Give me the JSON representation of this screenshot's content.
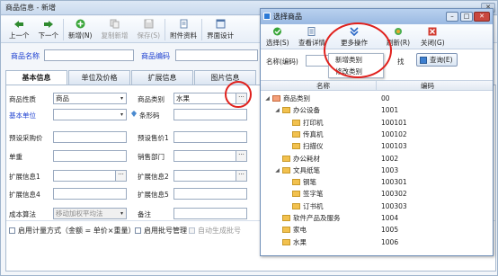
{
  "main": {
    "title": "商品信息 - 新增",
    "toolbar": {
      "prev": "上一个",
      "next": "下一个",
      "add": "新增(N)",
      "copy_add": "复制新增",
      "save": "保存(S)",
      "attach": "附件资料",
      "ui_design": "界面设计"
    },
    "name_label": "商品名称",
    "code_label": "商品编码",
    "tabs": [
      "基本信息",
      "单位及价格",
      "扩展信息",
      "图片信息"
    ],
    "fields": {
      "nature_label": "商品性质",
      "nature_value": "商品",
      "category_label": "商品类别",
      "category_value": "水果",
      "base_unit_label": "基本单位",
      "barcode_label": "条形码",
      "purchase_price_label": "预设采购价",
      "sale_price_label": "预设售价1",
      "weight_label": "单重",
      "sales_dept_label": "销售部门",
      "ext1_label": "扩展信息1",
      "ext2_label": "扩展信息2",
      "ext4_label": "扩展信息4",
      "ext5_label": "扩展信息5",
      "cost_label": "成本算法",
      "cost_value": "移动加权平均法",
      "remark_label": "备注"
    },
    "bottom": {
      "measure": "启用计量方式（金额 = 单价×重量）",
      "batch": "启用批号管理",
      "auto_batch": "自动生成批号"
    }
  },
  "dialog": {
    "title": "选择商品",
    "toolbar": {
      "select": "选择(S)",
      "details": "查看详情",
      "more": "更多操作",
      "refresh": "刷新(R)",
      "close": "关闭(G)"
    },
    "search_label": "名称(编码)",
    "partial_label": "找",
    "query": "查询(E)",
    "menu": [
      "新增类别",
      "修改类别"
    ],
    "columns": [
      "名称",
      "编码"
    ],
    "rows": [
      {
        "name": "商品类别",
        "code": "00",
        "level": 0,
        "toggle": "◢"
      },
      {
        "name": "办公设备",
        "code": "1001",
        "level": 1,
        "toggle": "◢"
      },
      {
        "name": "打印机",
        "code": "100101",
        "level": 2,
        "toggle": ""
      },
      {
        "name": "传真机",
        "code": "100102",
        "level": 2,
        "toggle": ""
      },
      {
        "name": "扫描仪",
        "code": "100103",
        "level": 2,
        "toggle": ""
      },
      {
        "name": "办公耗材",
        "code": "1002",
        "level": 1,
        "toggle": ""
      },
      {
        "name": "文具纸笔",
        "code": "1003",
        "level": 1,
        "toggle": "◢"
      },
      {
        "name": "钢笔",
        "code": "100301",
        "level": 2,
        "toggle": ""
      },
      {
        "name": "签字笔",
        "code": "100302",
        "level": 2,
        "toggle": ""
      },
      {
        "name": "订书机",
        "code": "100303",
        "level": 2,
        "toggle": ""
      },
      {
        "name": "软件产品及服务",
        "code": "1004",
        "level": 1,
        "toggle": ""
      },
      {
        "name": "家电",
        "code": "1005",
        "level": 1,
        "toggle": ""
      },
      {
        "name": "水果",
        "code": "1006",
        "level": 1,
        "toggle": ""
      }
    ]
  },
  "colors": {
    "highlight_ring": "#e0201c",
    "label_blue": "#1c3fd0"
  }
}
